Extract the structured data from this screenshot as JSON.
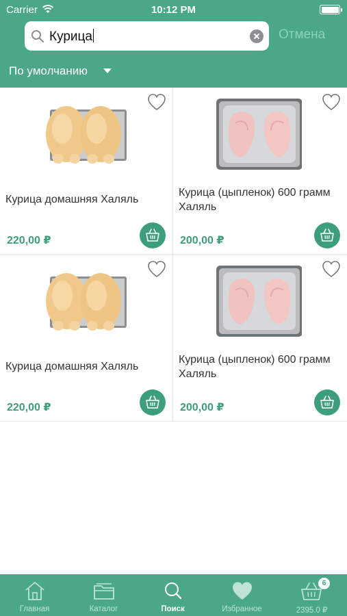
{
  "status": {
    "carrier": "Carrier",
    "time": "10:12 PM"
  },
  "search": {
    "value": "Курица",
    "cancel_label": "Отмена"
  },
  "sort": {
    "label": "По умолчанию"
  },
  "products": [
    {
      "title": "Курица домашняя Халяль",
      "price": "220,00 ₽",
      "image": "whole-chicken-image"
    },
    {
      "title": "Курица (цыпленок) 600 грамм Халяль",
      "price": "200,00 ₽",
      "image": "chicken-legs-image"
    },
    {
      "title": "Курица домашняя Халяль",
      "price": "220,00 ₽",
      "image": "whole-chicken-image"
    },
    {
      "title": "Курица (цыпленок) 600 грамм Халяль",
      "price": "200,00 ₽",
      "image": "chicken-legs-image"
    }
  ],
  "tabs": [
    {
      "label": "Главная",
      "icon": "home-icon"
    },
    {
      "label": "Каталог",
      "icon": "folder-icon"
    },
    {
      "label": "Поиск",
      "icon": "search-icon",
      "active": true
    },
    {
      "label": "Избранное",
      "icon": "heart-icon"
    },
    {
      "label": "2395.0 ₽",
      "icon": "basket-icon",
      "badge": "6"
    }
  ],
  "colors": {
    "brand": "#4aa889",
    "price": "#3d9e7e",
    "cancel": "#8cd3bb"
  }
}
